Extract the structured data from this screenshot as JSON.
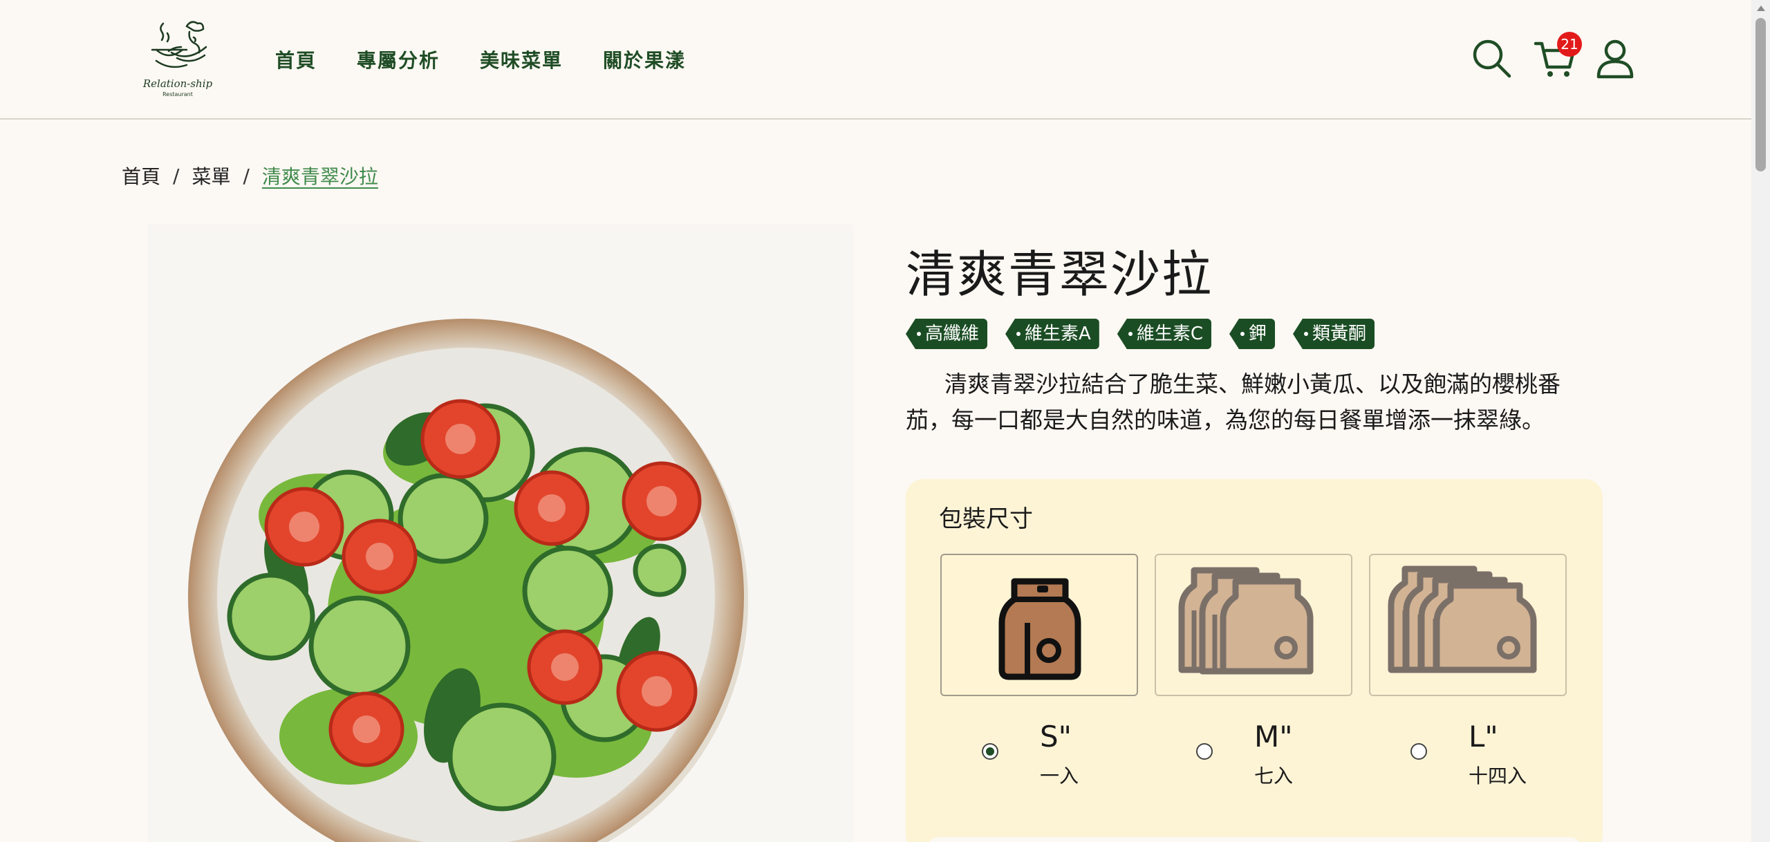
{
  "header": {
    "logo_text": "Relation-ship",
    "logo_subtext": "Restaurant",
    "nav": [
      {
        "label": "首頁"
      },
      {
        "label": "專屬分析"
      },
      {
        "label": "美味菜單"
      },
      {
        "label": "關於果漾"
      }
    ],
    "icons": {
      "search": "search-icon",
      "cart": "cart-icon",
      "user": "user-icon"
    },
    "cart_count": "21"
  },
  "breadcrumb": {
    "items": [
      "首頁",
      "菜單"
    ],
    "current": "清爽青翠沙拉",
    "separator": "/"
  },
  "product": {
    "image_alt": "salad-bowl",
    "title": "清爽青翠沙拉",
    "tags": [
      "高纖維",
      "維生素A",
      "維生素C",
      "鉀",
      "類黃酮"
    ],
    "description": "清爽青翠沙拉結合了脆生菜、鮮嫩小黃瓜、以及飽滿的櫻桃番茄，每一口都是大自然的味道，為您的每日餐單增添一抹翠綠。"
  },
  "packaging": {
    "label": "包裝尺寸",
    "options": [
      {
        "size": "S\"",
        "qty": "一入",
        "selected": true
      },
      {
        "size": "M\"",
        "qty": "七入",
        "selected": false
      },
      {
        "size": "L\"",
        "qty": "十四入",
        "selected": false
      }
    ]
  },
  "colors": {
    "brand_green": "#1f4d25",
    "tag_green": "#1b4d24",
    "breadcrumb_active": "#3f8a4c",
    "badge_red": "#e21a1a",
    "pack_bg": "#fdf4d6",
    "page_bg": "#fcf8f3"
  }
}
